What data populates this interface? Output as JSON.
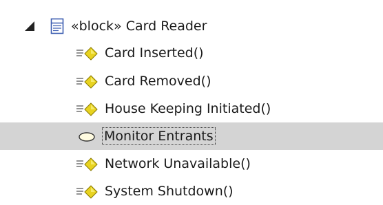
{
  "tree": {
    "root": {
      "label": "«block» Card Reader",
      "icon": "block-class-icon",
      "expanded": true
    },
    "children": [
      {
        "label": "Card Inserted()",
        "icon": "operation-icon",
        "selected": false
      },
      {
        "label": "Card Removed()",
        "icon": "operation-icon",
        "selected": false
      },
      {
        "label": "House Keeping Initiated()",
        "icon": "operation-icon",
        "selected": false
      },
      {
        "label": "Monitor Entrants",
        "icon": "state-icon",
        "selected": true
      },
      {
        "label": "Network Unavailable()",
        "icon": "operation-icon",
        "selected": false
      },
      {
        "label": "System Shutdown()",
        "icon": "operation-icon",
        "selected": false
      }
    ]
  },
  "colors": {
    "selection_bg": "#d4d4d4",
    "operation_diamond": "#e8d320",
    "block_icon": "#3a5bb0"
  }
}
